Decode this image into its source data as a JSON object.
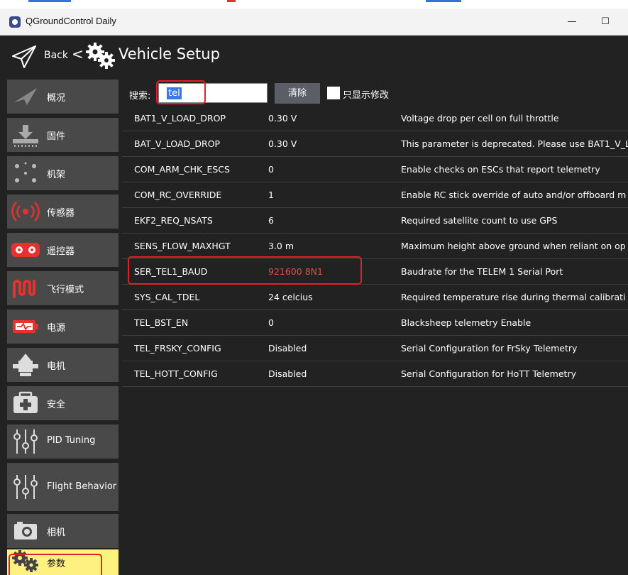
{
  "window": {
    "title": "QGroundControl Daily",
    "minimize_glyph": "—",
    "maximize_glyph": "☐"
  },
  "toolbar": {
    "back_label": "Back",
    "separator": "<",
    "title": "Vehicle Setup",
    "back_icon": "paper-plane-icon",
    "setup_icon": "gears-icon"
  },
  "sidebar": {
    "items": [
      {
        "label": "概况",
        "icon": "plane-icon"
      },
      {
        "label": "固件",
        "icon": "firmware-download-icon"
      },
      {
        "label": "机架",
        "icon": "airframe-icon"
      },
      {
        "label": "传感器",
        "icon": "sensors-icon"
      },
      {
        "label": "遥控器",
        "icon": "radio-icon"
      },
      {
        "label": "飞行模式",
        "icon": "flight-modes-icon"
      },
      {
        "label": "电源",
        "icon": "battery-icon"
      },
      {
        "label": "电机",
        "icon": "motors-icon"
      },
      {
        "label": "安全",
        "icon": "safety-icon"
      },
      {
        "label": "PID Tuning",
        "icon": "tuning-sliders-icon"
      },
      {
        "label": "Flight Behavior",
        "icon": "behavior-sliders-icon"
      },
      {
        "label": "相机",
        "icon": "camera-icon"
      },
      {
        "label": "参数",
        "icon": "parameters-gears-icon",
        "active": true
      }
    ]
  },
  "search": {
    "label": "搜索:",
    "value": "tel",
    "clear_label": "清除",
    "show_modified_label": "只显示修改",
    "show_modified_checked": false
  },
  "params": [
    {
      "name": "BAT1_V_LOAD_DROP",
      "value": "0.30 V",
      "desc": "Voltage drop per cell on full throttle"
    },
    {
      "name": "BAT_V_LOAD_DROP",
      "value": "0.30 V",
      "desc": "This parameter is deprecated. Please use BAT1_V_L"
    },
    {
      "name": "COM_ARM_CHK_ESCS",
      "value": "0",
      "desc": "Enable checks on ESCs that report telemetry"
    },
    {
      "name": "COM_RC_OVERRIDE",
      "value": "1",
      "desc": "Enable RC stick override of auto and/or offboard m"
    },
    {
      "name": "EKF2_REQ_NSATS",
      "value": "6",
      "desc": "Required satellite count to use GPS"
    },
    {
      "name": "SENS_FLOW_MAXHGT",
      "value": "3.0 m",
      "desc": "Maximum height above ground when reliant on op"
    },
    {
      "name": "SER_TEL1_BAUD",
      "value": "921600 8N1",
      "desc": "Baudrate for the TELEM 1 Serial Port",
      "modified": true
    },
    {
      "name": "SYS_CAL_TDEL",
      "value": "24 celcius",
      "desc": "Required temperature rise during thermal calibrati"
    },
    {
      "name": "TEL_BST_EN",
      "value": "0",
      "desc": "Blacksheep telemetry Enable"
    },
    {
      "name": "TEL_FRSKY_CONFIG",
      "value": "Disabled",
      "desc": "Serial Configuration for FrSky Telemetry"
    },
    {
      "name": "TEL_HOTT_CONFIG",
      "value": "Disabled",
      "desc": "Serial Configuration for HoTT Telemetry"
    }
  ],
  "colors": {
    "background": "#222222",
    "nav_item": "#494949",
    "nav_active": "#fff17f",
    "modified_value": "#e0504a",
    "annotation": "#e0202a",
    "icon_red": "#e8312f"
  }
}
